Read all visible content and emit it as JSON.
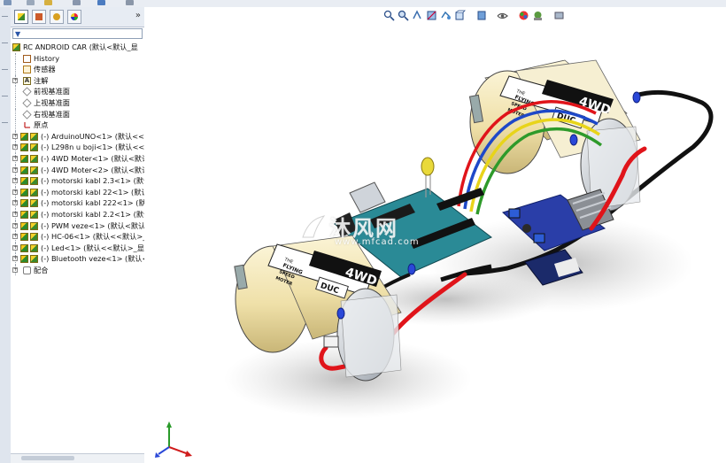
{
  "toolbar_expand": "»",
  "filter_icon": "▼",
  "tree": {
    "root": "RC ANDROID CAR  (默认<默认_显",
    "items": [
      {
        "label": "History",
        "icon": "history-icon"
      },
      {
        "label": "传感器",
        "icon": "sensor-icon"
      },
      {
        "label": "注解",
        "icon": "annotation-icon"
      },
      {
        "label": "前视基准面",
        "icon": "plane-icon"
      },
      {
        "label": "上视基准面",
        "icon": "plane-icon"
      },
      {
        "label": "右视基准面",
        "icon": "plane-icon"
      },
      {
        "label": "原点",
        "icon": "origin-icon"
      },
      {
        "label": "(-) ArduinoUNO<1> (默认<<默",
        "icon": "part-icon"
      },
      {
        "label": "(-) L298n u boji<1> (默认<<默",
        "icon": "part-icon"
      },
      {
        "label": "(-) 4WD Moter<1> (默认<默认",
        "icon": "part-icon"
      },
      {
        "label": "(-) 4WD Moter<2> (默认<默认",
        "icon": "part-icon"
      },
      {
        "label": "(-) motorski kabl 2.3<1> (默认",
        "icon": "part-icon"
      },
      {
        "label": "(-) motorski kabl 22<1> (默认",
        "icon": "part-icon"
      },
      {
        "label": "(-) motorski kabl 222<1> (默认",
        "icon": "part-icon"
      },
      {
        "label": "(-) motorski kabl 2.2<1> (默认",
        "icon": "part-icon"
      },
      {
        "label": "(-) PWM veze<1> (默认<默认",
        "icon": "part-icon"
      },
      {
        "label": "(-) HC-06<1> (默认<<默认>_显",
        "icon": "part-icon"
      },
      {
        "label": "(-) Led<1> (默认<<默认>_显示",
        "icon": "part-icon"
      },
      {
        "label": "(-) Bluetooth veze<1> (默认<<默",
        "icon": "part-icon"
      },
      {
        "label": "配合",
        "icon": "mates-icon"
      }
    ]
  },
  "model": {
    "motor_label_big": "4WD",
    "motor_label_small": "DUC",
    "motor_text_lines": [
      "THE",
      "FLYING",
      "SPEED",
      "MOTER"
    ]
  },
  "watermark": {
    "main": "沐风网",
    "sub": "www.mfcad.com"
  },
  "colors": {
    "panel_bg": "#ffffff",
    "tab_bar": "#e7ecf3",
    "motor_can": "#f2e6b8",
    "motor_end": "#d9dde2",
    "wire_red": "#e0141a",
    "wire_black": "#111111",
    "arduino_board": "#2a8a96",
    "driver_board": "#2a3ea8",
    "bt_board": "#1b2a6a"
  }
}
